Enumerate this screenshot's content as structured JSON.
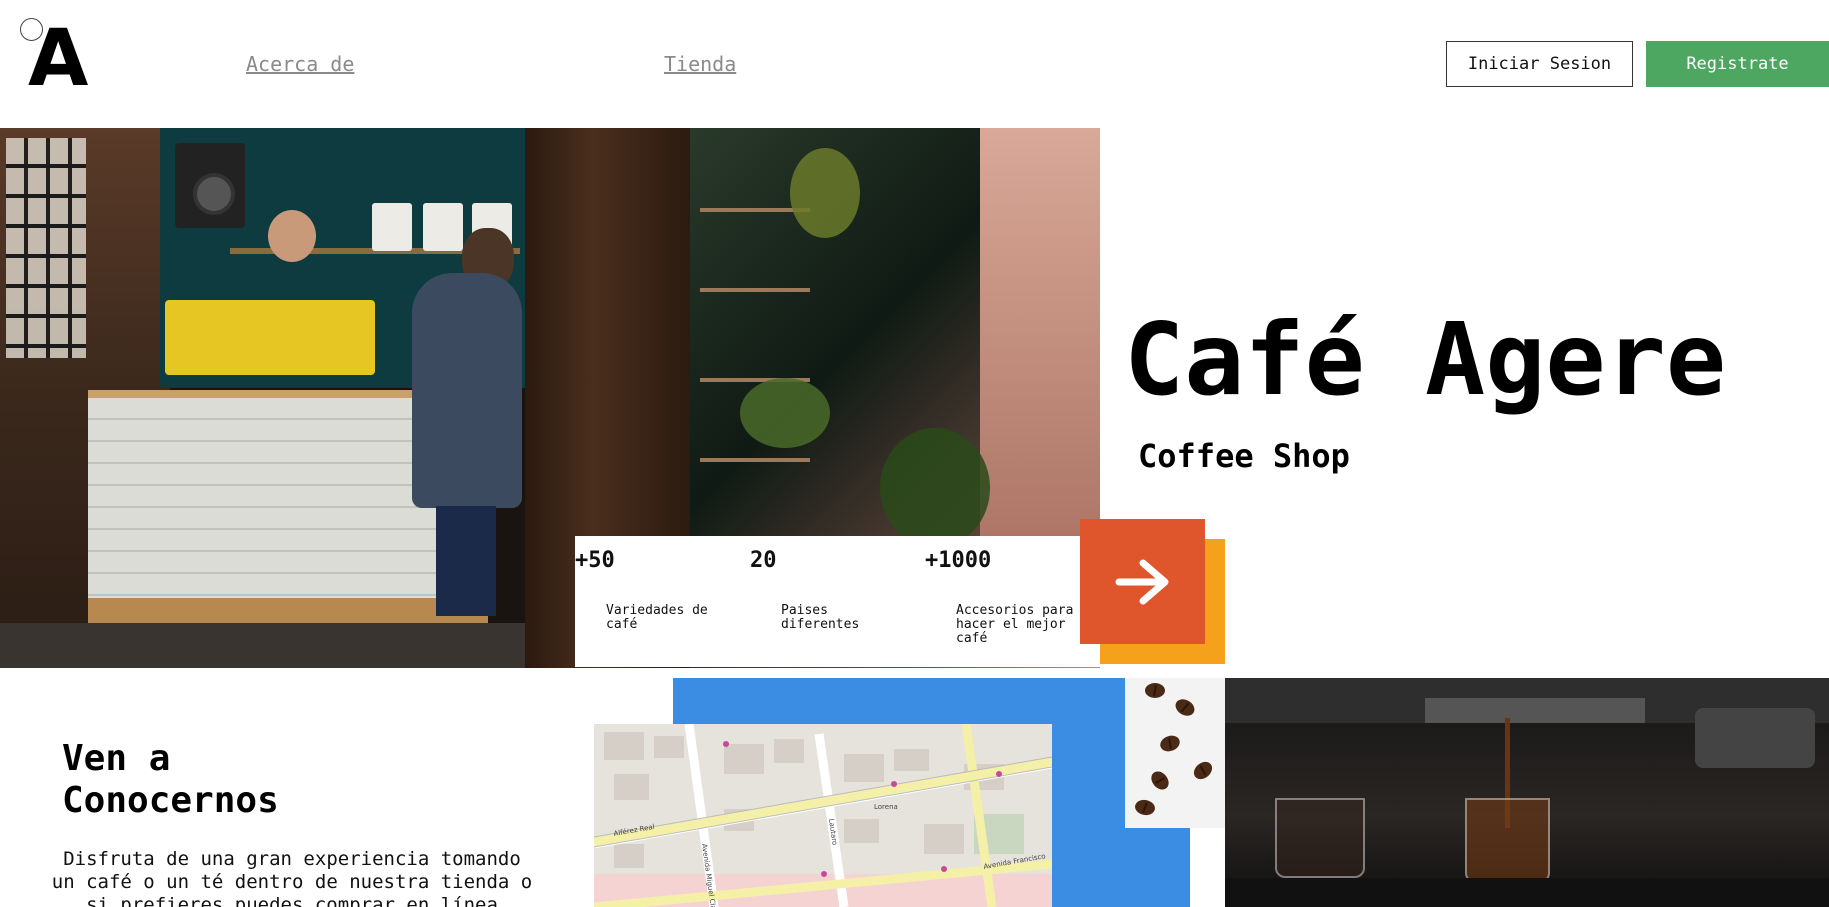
{
  "header": {
    "logo": "A",
    "nav": [
      {
        "label": "Acerca de"
      },
      {
        "label": "Tienda"
      }
    ],
    "login_label": "Iniciar Sesion",
    "register_label": "Registrate"
  },
  "hero": {
    "title": "Café Agere",
    "subtitle": "Coffee Shop",
    "stats": [
      {
        "value": "+50",
        "label": "Variedades de café"
      },
      {
        "value": "20",
        "label": "Paises diferentes"
      },
      {
        "value": "+1000",
        "label": "Accesorios para hacer el mejor café"
      }
    ],
    "arrow_icon": "arrow-right-icon"
  },
  "visit": {
    "title": "Ven a Conocernos",
    "text": "Disfruta de una gran experiencia tomando un café o un té dentro de nuestra tienda o si prefieres puedes comprar en línea"
  },
  "map": {
    "streets": [
      "Alférez Real",
      "Avenida Miguel Claro",
      "Lorena",
      "Avenida Francisco",
      "Lautaro"
    ]
  },
  "colors": {
    "register_green": "#4ea760",
    "arrow_orange": "#e0562c",
    "arrow_shadow_yellow": "#f5a11c",
    "blue_block": "#3a8de2"
  }
}
